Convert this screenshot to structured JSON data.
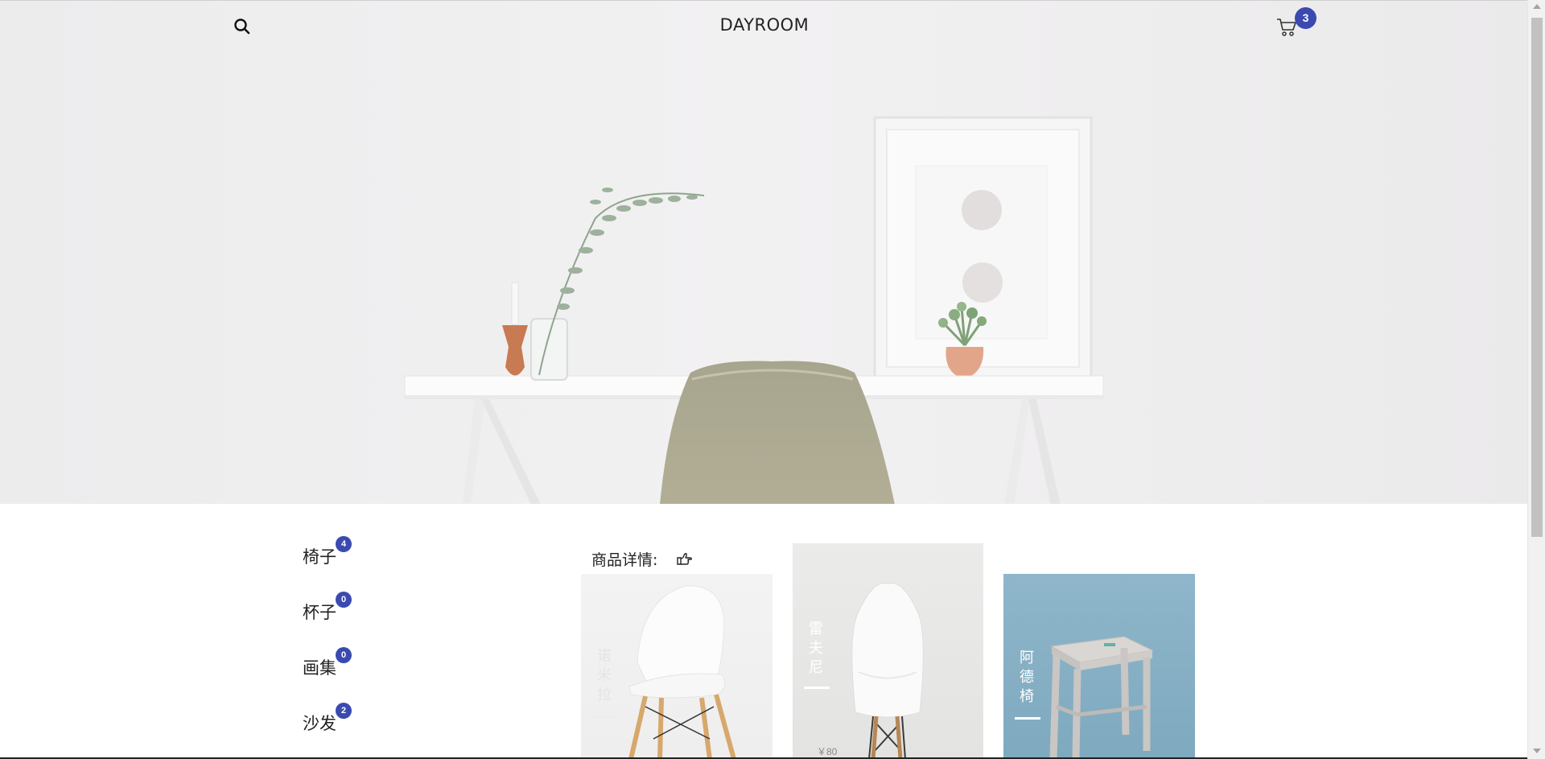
{
  "header": {
    "logo": "DAYROOM",
    "search_icon": "search-icon",
    "cart_icon": "cart-icon",
    "cart_count": "3"
  },
  "categories": [
    {
      "label": "椅子",
      "count": "4"
    },
    {
      "label": "杯子",
      "count": "0"
    },
    {
      "label": "画集",
      "count": "0"
    },
    {
      "label": "沙发",
      "count": "2"
    }
  ],
  "detail": {
    "heading": "商品详情:",
    "icon": "pointing-hand-icon"
  },
  "products": [
    {
      "name": "诺米拉",
      "price": ""
    },
    {
      "name": "雷夫尼",
      "price": "￥80"
    },
    {
      "name": "阿德椅",
      "price": ""
    }
  ],
  "colors": {
    "accent": "#3a4ab0"
  }
}
